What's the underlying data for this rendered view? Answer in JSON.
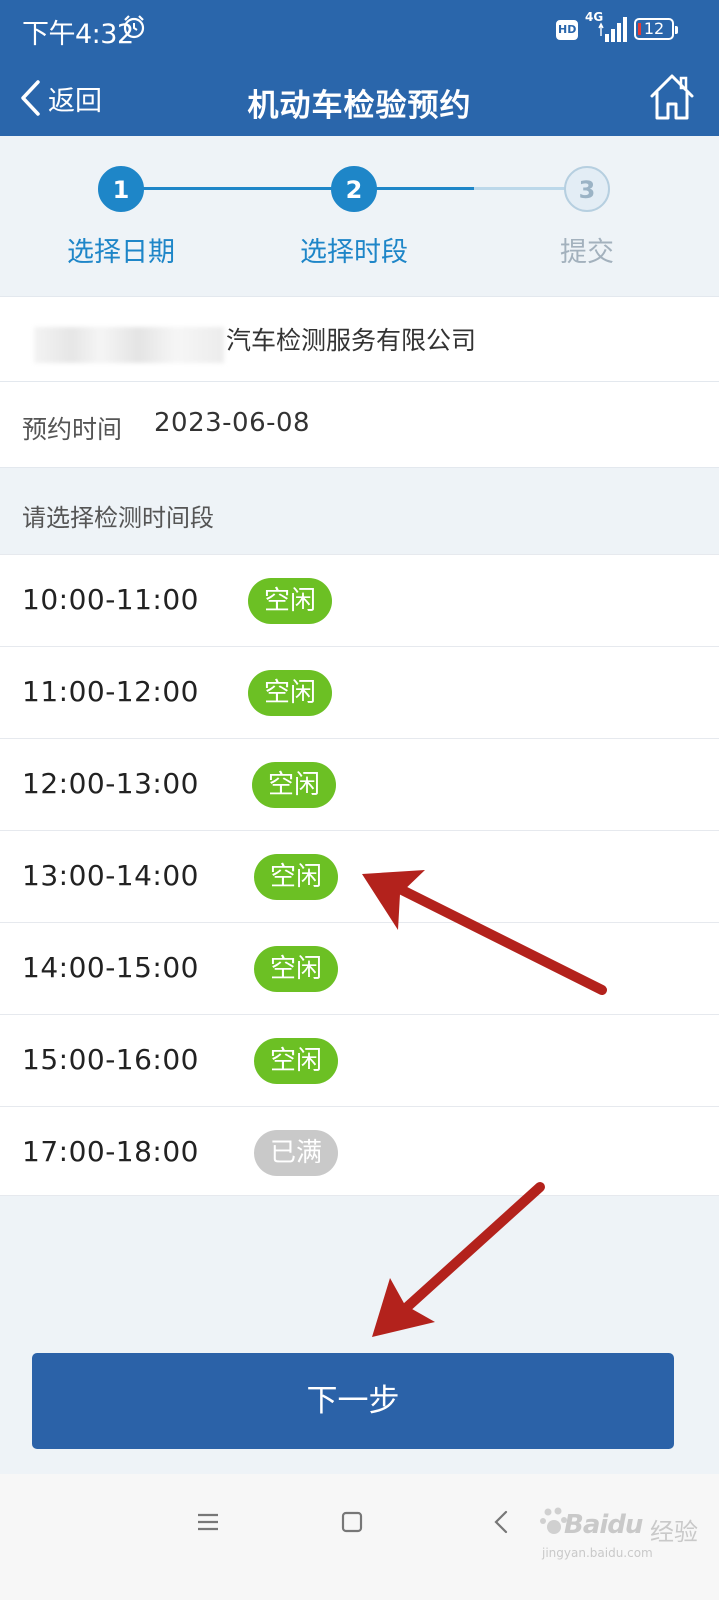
{
  "status_bar": {
    "time": "下午4:32",
    "hd": "HD",
    "network": "4G",
    "battery": "12"
  },
  "nav": {
    "back_label": "返回",
    "title": "机动车检验预约"
  },
  "steps": [
    {
      "number": "1",
      "label": "选择日期",
      "state": "active"
    },
    {
      "number": "2",
      "label": "选择时段",
      "state": "active"
    },
    {
      "number": "3",
      "label": "提交",
      "state": "inactive"
    }
  ],
  "company": {
    "name": "汽车检测服务有限公司"
  },
  "appointment": {
    "label": "预约时间",
    "date": "2023-06-08"
  },
  "prompt": "请选择检测时间段",
  "slots": [
    {
      "time": "10:00-11:00",
      "status": "空闲",
      "available": true
    },
    {
      "time": "11:00-12:00",
      "status": "空闲",
      "available": true
    },
    {
      "time": "12:00-13:00",
      "status": "空闲",
      "available": true
    },
    {
      "time": "13:00-14:00",
      "status": "空闲",
      "available": true
    },
    {
      "time": "14:00-15:00",
      "status": "空闲",
      "available": true
    },
    {
      "time": "15:00-16:00",
      "status": "空闲",
      "available": true
    },
    {
      "time": "17:00-18:00",
      "status": "已满",
      "available": false
    }
  ],
  "next_button": "下一步",
  "colors": {
    "header": "#2a66ab",
    "step_active": "#1e86c8",
    "badge_free": "#6cc024",
    "badge_full": "#c9c9c9",
    "arrow": "#b3221c"
  },
  "watermark": {
    "brand": "Baidu",
    "suffix": "经验",
    "url": "jingyan.baidu.com"
  }
}
